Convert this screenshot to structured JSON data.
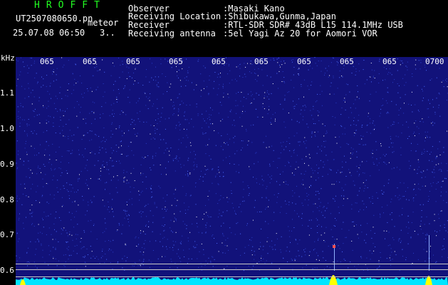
{
  "header": {
    "brand": "HROFFT",
    "filename": "UT2507080650.pn",
    "mode": "meteor",
    "datetime": "25.07.08 06:50",
    "count": "3..",
    "fields": [
      {
        "label": "Observer",
        "value": ":Masaki Kano"
      },
      {
        "label": "Receiving Location",
        "value": ":Shibukawa,Gunma,Japan"
      },
      {
        "label": "Receiver",
        "value": ":RTL-SDR SDR# 43dB L15 114.1MHz USB"
      },
      {
        "label": "Receiving antenna",
        "value": ":5el Yagi Az 20 for Aomori VOR"
      }
    ]
  },
  "plot": {
    "unit": "kHz",
    "y_ticks": [
      "1.1",
      "1.0",
      "0.9",
      "0.8",
      "0.7",
      "0.6"
    ],
    "time_ticks": [
      "065",
      "065",
      "065",
      "065",
      "065",
      "065",
      "065",
      "065",
      "065",
      "0700"
    ],
    "colors": {
      "background": "#12127a",
      "noise": "#4a6aff",
      "baseline": "#00e5ff",
      "peak": "#ffff00"
    }
  }
}
